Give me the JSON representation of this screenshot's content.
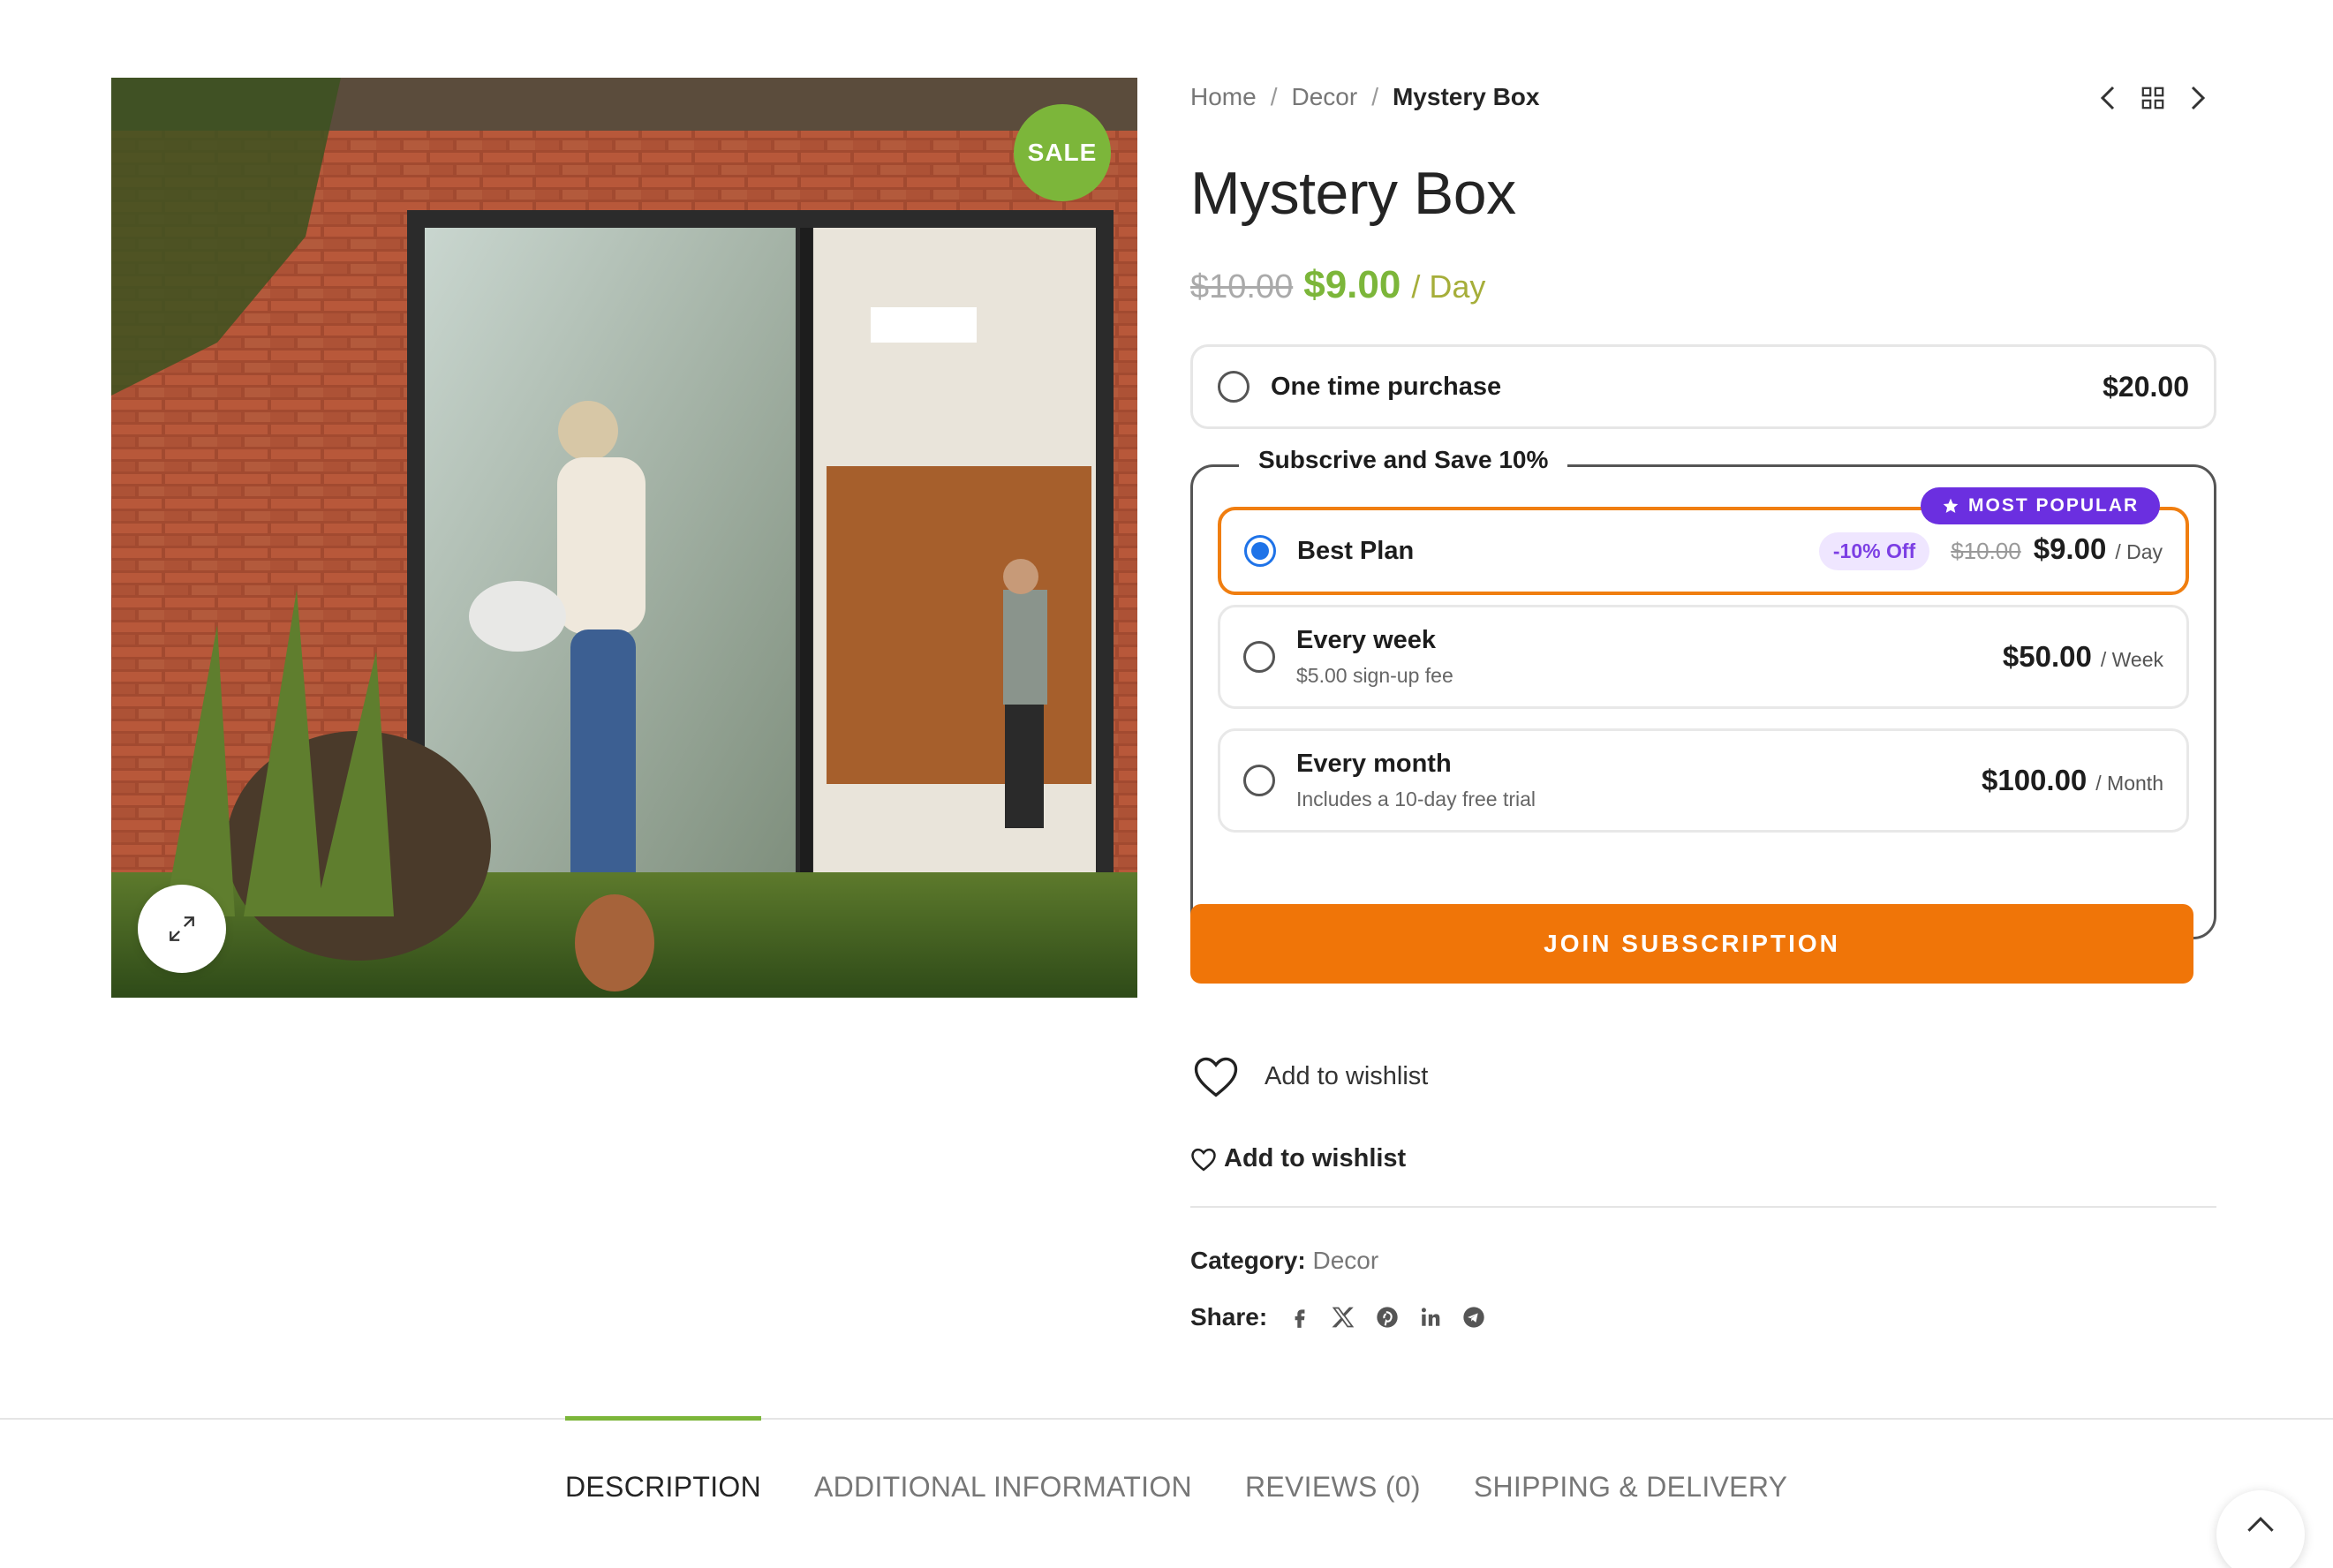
{
  "gallery": {
    "sale_label": "SALE"
  },
  "breadcrumb": {
    "items": [
      "Home",
      "Decor"
    ],
    "current": "Mystery Box",
    "separator": "/"
  },
  "product": {
    "title": "Mystery Box",
    "price_old": "$10.00",
    "price_new": "$9.00",
    "price_unit": "/ Day"
  },
  "options": {
    "one_time": {
      "label": "One time purchase",
      "price": "$20.00"
    },
    "subscribe_legend": "Subscrive and Save 10%",
    "plans": [
      {
        "title": "Best Plan",
        "badge": "MOST POPULAR",
        "discount": "-10% Off",
        "price_old": "$10.00",
        "price": "$9.00",
        "unit": "/ Day",
        "selected": true
      },
      {
        "title": "Every week",
        "sub": "$5.00 sign-up fee",
        "price": "$50.00",
        "unit": "/ Week",
        "selected": false
      },
      {
        "title": "Every month",
        "sub": "Includes a 10-day free trial",
        "price": "$100.00",
        "unit": "/ Month",
        "selected": false
      }
    ]
  },
  "actions": {
    "join_label": "JOIN SUBSCRIPTION",
    "wishlist_label_1": "Add to wishlist",
    "wishlist_label_2": "Add to wishlist"
  },
  "meta": {
    "category_label": "Category:",
    "category_value": "Decor",
    "share_label": "Share:",
    "share_icons": [
      "facebook-icon",
      "x-icon",
      "pinterest-icon",
      "linkedin-icon",
      "telegram-icon"
    ]
  },
  "tabs": [
    {
      "label": "DESCRIPTION",
      "active": true
    },
    {
      "label": "ADDITIONAL INFORMATION",
      "active": false
    },
    {
      "label": "REVIEWS (0)",
      "active": false
    },
    {
      "label": "SHIPPING & DELIVERY",
      "active": false
    }
  ],
  "colors": {
    "accent_green": "#7cb63a",
    "accent_orange": "#f07508",
    "popular_purple": "#6b2fe0",
    "radio_blue": "#1f73e8"
  }
}
